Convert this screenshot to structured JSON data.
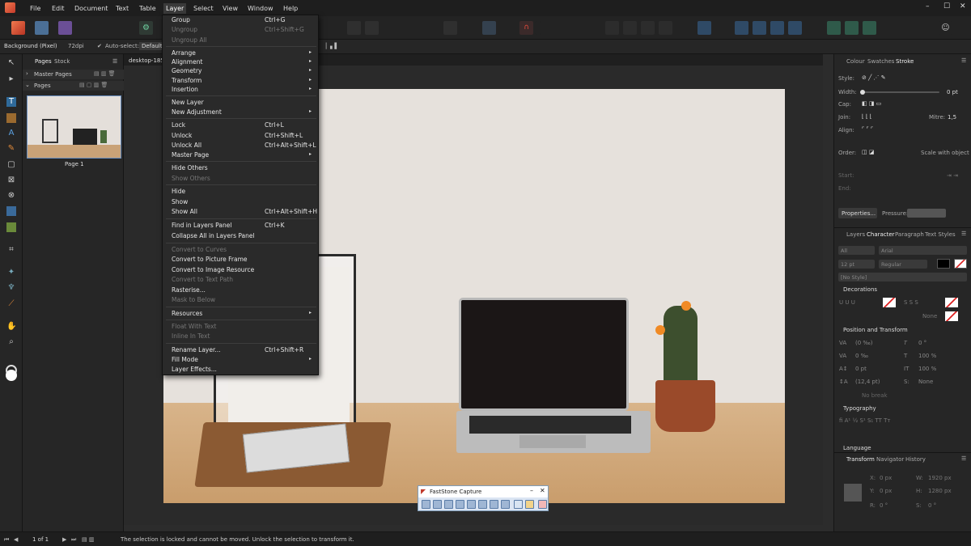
{
  "menubar": {
    "items": [
      "File",
      "Edit",
      "Document",
      "Text",
      "Table",
      "Layer",
      "Select",
      "View",
      "Window",
      "Help"
    ],
    "active": "Layer"
  },
  "context_toolbar": {
    "layer_name": "Background (Pixel)",
    "dpi": "72dpi",
    "autoselect_label": "Auto-select:",
    "autoselect_value": "Default"
  },
  "pages_panel": {
    "tabs": [
      "Pages",
      "Stock"
    ],
    "master_pages": "Master Pages",
    "pages": "Pages",
    "page_label": "Page 1"
  },
  "document_tab": "desktop-185",
  "layer_menu": {
    "items": [
      {
        "label": "Group",
        "shortcut": "Ctrl+G"
      },
      {
        "label": "Ungroup",
        "shortcut": "Ctrl+Shift+G",
        "disabled": true
      },
      {
        "label": "Ungroup All",
        "disabled": true
      },
      {
        "label": "Arrange",
        "submenu": true
      },
      {
        "label": "Alignment",
        "submenu": true
      },
      {
        "label": "Geometry",
        "submenu": true
      },
      {
        "label": "Transform",
        "submenu": true
      },
      {
        "label": "Insertion",
        "submenu": true
      },
      {
        "label": "New Layer"
      },
      {
        "label": "New Adjustment",
        "submenu": true
      },
      {
        "label": "Lock",
        "shortcut": "Ctrl+L"
      },
      {
        "label": "Unlock",
        "shortcut": "Ctrl+Shift+L"
      },
      {
        "label": "Unlock All",
        "shortcut": "Ctrl+Alt+Shift+L"
      },
      {
        "label": "Master Page",
        "submenu": true
      },
      {
        "label": "Hide Others"
      },
      {
        "label": "Show Others",
        "disabled": true
      },
      {
        "label": "Hide"
      },
      {
        "label": "Show"
      },
      {
        "label": "Show All",
        "shortcut": "Ctrl+Alt+Shift+H"
      },
      {
        "label": "Find in Layers Panel",
        "shortcut": "Ctrl+K"
      },
      {
        "label": "Collapse All in Layers Panel"
      },
      {
        "label": "Convert to Curves",
        "disabled": true
      },
      {
        "label": "Convert to Picture Frame"
      },
      {
        "label": "Convert to Image Resource"
      },
      {
        "label": "Convert to Text Path",
        "disabled": true
      },
      {
        "label": "Rasterise..."
      },
      {
        "label": "Mask to Below",
        "disabled": true
      },
      {
        "label": "Resources",
        "submenu": true
      },
      {
        "label": "Float With Text",
        "disabled": true
      },
      {
        "label": "Inline In Text",
        "disabled": true
      },
      {
        "label": "Rename Layer...",
        "shortcut": "Ctrl+Shift+R"
      },
      {
        "label": "Fill Mode",
        "submenu": true
      },
      {
        "label": "Layer Effects..."
      }
    ]
  },
  "stroke_panel": {
    "tabs": [
      "Colour",
      "Swatches",
      "Stroke"
    ],
    "style_label": "Style:",
    "width_label": "Width:",
    "width_value": "0 pt",
    "cap_label": "Cap:",
    "join_label": "Join:",
    "mitre_label": "Mitre:",
    "mitre_value": "1,5",
    "align_label": "Align:",
    "order_label": "Order:",
    "scale_label": "Scale with object",
    "start_label": "Start:",
    "end_label": "End:",
    "properties_button": "Properties...",
    "pressure_label": "Pressure:"
  },
  "character_panel": {
    "tabs": [
      "Layers",
      "Character",
      "Paragraph",
      "Text Styles"
    ],
    "scope": "All",
    "font": "Arial",
    "size": "12 pt",
    "weight": "Regular",
    "style": "[No Style]",
    "decorations": "Decorations",
    "none_label": "None",
    "position_transform": "Position and Transform",
    "kerning": "(0 ‰)",
    "tracking": "0 ‰",
    "baseline": "0 pt",
    "leading": "(12,4 pt)",
    "skew": "0 °",
    "hscale": "100 %",
    "vscale": "100 %",
    "no_break": "No break",
    "none2": "None",
    "typography": "Typography",
    "language": "Language"
  },
  "transform_panel": {
    "tabs": [
      "Transform",
      "Navigator",
      "History"
    ],
    "x_label": "X:",
    "x": "0 px",
    "y_label": "Y:",
    "y": "0 px",
    "w_label": "W:",
    "w": "1920 px",
    "h_label": "H:",
    "h": "1280 px",
    "r_label": "R:",
    "r": "0 °",
    "s_label": "S:",
    "s": "0 °"
  },
  "status": {
    "page": "1 of 1",
    "message": "The selection is locked and cannot be moved. Unlock the selection to transform it."
  },
  "faststone": {
    "title": "FastStone Capture"
  }
}
